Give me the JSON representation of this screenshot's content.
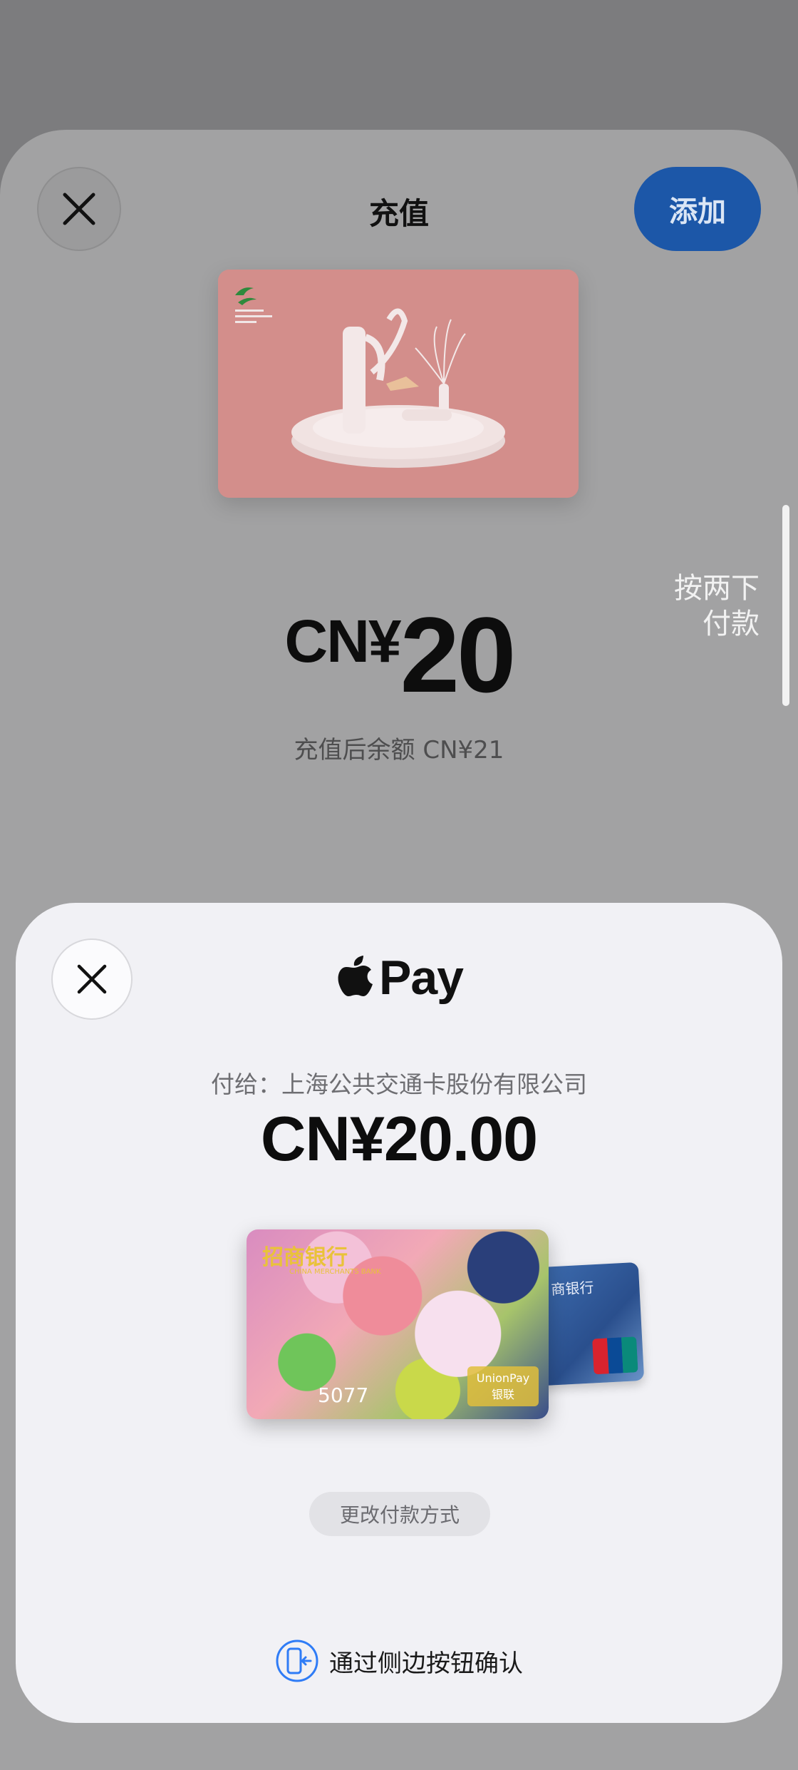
{
  "top_up": {
    "title": "充值",
    "add_label": "添加",
    "amount_currency": "CN¥",
    "amount_value": "20",
    "balance_after": "充值后余额 CN¥21"
  },
  "side_hint": {
    "line1": "按两下",
    "line2": "付款"
  },
  "apple_pay": {
    "logo_text": "Pay",
    "payee": "付给：上海公共交通卡股份有限公司",
    "amount": "CN¥20.00",
    "card": {
      "bank_name": "招商银行",
      "bank_name_en": "CHINA MERCHANTS BANK",
      "last4": "5077",
      "network_en": "UnionPay",
      "network_cn": "银联"
    },
    "back_card_bank": "商银行",
    "change_payment": "更改付款方式",
    "confirm_hint": "通过侧边按钮确认"
  },
  "colors": {
    "add_button": "#1c57a8",
    "backdrop": "#7c7c7e",
    "pay_sheet": "#f1f1f5",
    "confirm_icon": "#2f7cf6"
  }
}
